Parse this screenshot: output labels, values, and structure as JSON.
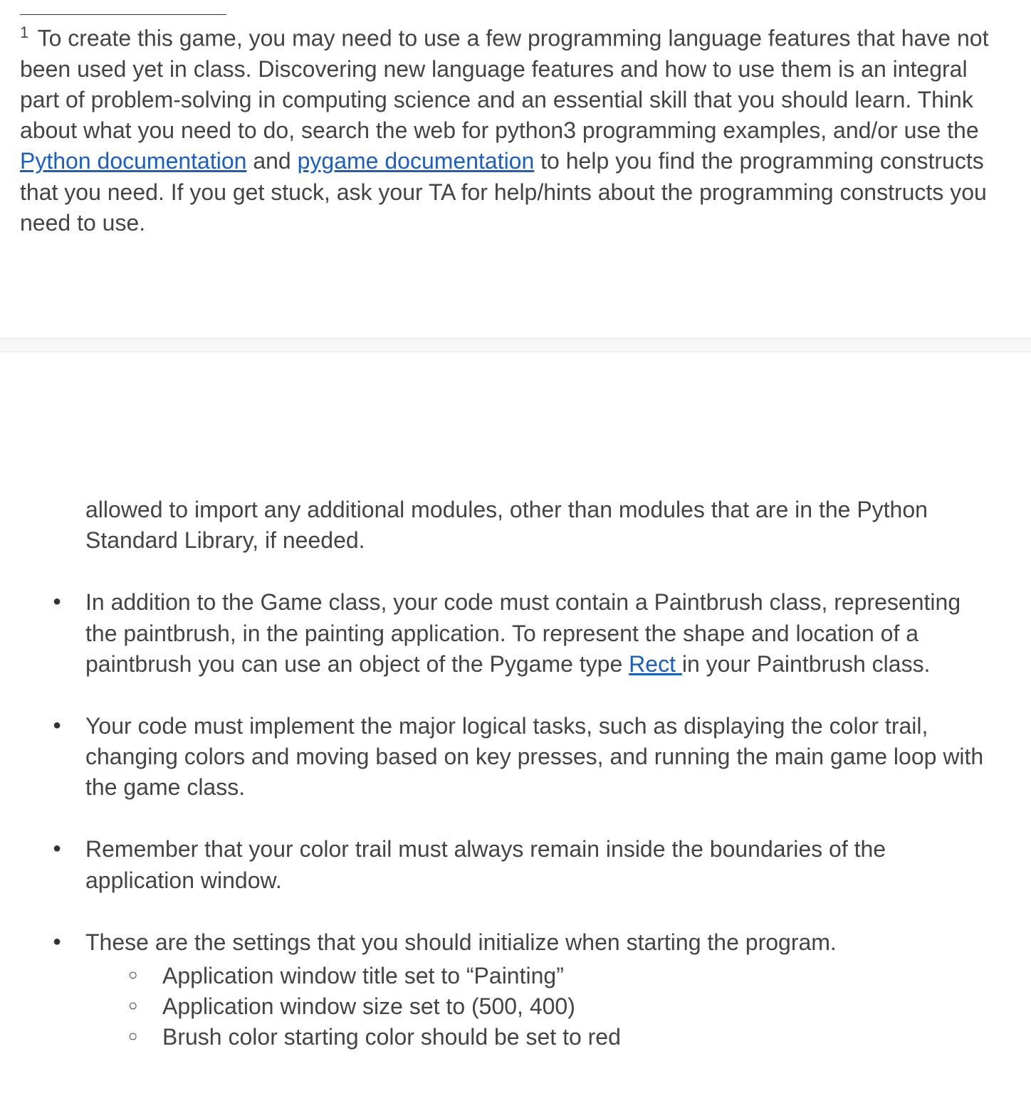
{
  "footnote": {
    "marker": "1",
    "pre": " To create this game, you may need to use a few programming language features that have not been used yet in class. Discovering new language features and how to use them is an integral part of problem-solving in computing science and an essential skill that you should learn. Think about what you need to do,  search the web for python3 programming examples, and/or use the ",
    "link1": "Python documentation",
    "mid1": " and ",
    "link2": "pygame documentation",
    "post": " to help you find the programming constructs that you need. If you get stuck, ask your TA for help/hints about the programming constructs you need to use."
  },
  "continued": "allowed to import any additional modules, other than modules that are in the Python Standard Library, if needed.",
  "bullets": {
    "b1": {
      "pre": "In addition to the Game class, your code must contain a Paintbrush class, representing the paintbrush, in the painting application. To represent the shape and location of a paintbrush you can use an object of the Pygame type ",
      "link": "Rect ",
      "post": " in your Paintbrush class."
    },
    "b2": "Your code must implement the major logical tasks, such as displaying the color trail, changing colors and moving based on key presses, and running the main game loop with the game class.",
    "b3": "Remember that your color trail must always remain inside the boundaries of the application window.",
    "b4": {
      "intro": "These are the settings that you should initialize when starting the program.",
      "sub": {
        "s1": "Application window title set to “Painting”",
        "s2": "Application window size set to (500, 400)",
        "s3": "Brush color starting color should be set to red"
      }
    }
  }
}
